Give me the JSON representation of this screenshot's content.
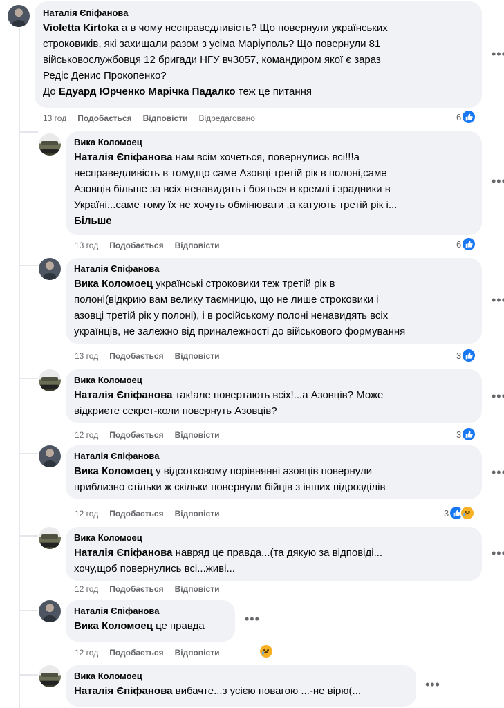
{
  "comments": [
    {
      "author": "Наталія Єпіфанова",
      "mentions": [
        "Violetta Kirtoka"
      ],
      "lines": [
        " а в чому несправедливість? Що повернули українських",
        "строковиків, які захищали разом з усіма Маріуполь? Що повернули 81",
        "військовослужбовця 12 бригади НГУ вч3057, командиром якої є зараз",
        "Редіс Денис Прокопенко?"
      ],
      "last_prefix": "До ",
      "last_mentions": "Едуард Юрченко Марічка Падалко",
      "last_suffix": " теж це питання",
      "time": "13 год",
      "like": "Подобається",
      "reply": "Відповісти",
      "edited": "Відредаговано",
      "reactions": "6"
    },
    {
      "author": "Вика Коломоец",
      "mention": "Наталія Єпіфанова",
      "lines": [
        " нам всім хочеться, повернулись всі!!!а",
        "несправедливість в тому,що саме Азовці третій рік в полоні,саме",
        "Азовців більше за всіх ненавидять і бояться в кремлі і зрадники в",
        "Україні...саме тому їх не хочуть обмінювати ,а катують третій рік і..."
      ],
      "more": "Більше",
      "time": "13 год",
      "like": "Подобається",
      "reply": "Відповісти",
      "reactions": "6"
    },
    {
      "author": "Наталія Єпіфанова",
      "mention": "Вика Коломоец",
      "lines": [
        " українські строковики теж третій рік в",
        "полоні(відкрию вам велику таємницю, що не лише строковики і",
        "азовці третій рік у полоні), і в російському полоні ненавидять всіх",
        "українців, не залежно від приналежності до військового формування"
      ],
      "time": "13 год",
      "like": "Подобається",
      "reply": "Відповісти",
      "reactions": "3"
    },
    {
      "author": "Вика Коломоец",
      "mention": "Наталія Єпіфанова",
      "lines": [
        " так!але повертають всіх!...а Азовців? Може",
        "відкриєте секрет-коли повернуть Азовців?"
      ],
      "time": "12 год",
      "like": "Подобається",
      "reply": "Відповісти",
      "reactions": "3"
    },
    {
      "author": "Наталія Єпіфанова",
      "mention": "Вика Коломоец",
      "lines": [
        " у відсотковому порівнянні азовців повернули",
        "приблизно стільки ж скільки повернули бійців з інших підрозділів"
      ],
      "time": "12 год",
      "like": "Подобається",
      "reply": "Відповісти",
      "reactions": "3"
    },
    {
      "author": "Вика Коломоец",
      "mention": "Наталія Єпіфанова",
      "lines": [
        " навряд це правда...(та дякую за відповіді...",
        "хочу,щоб повернулись всі...живі..."
      ],
      "time": "12 год",
      "like": "Подобається",
      "reply": "Відповісти"
    },
    {
      "author": "Наталія Єпіфанова",
      "mention": "Вика Коломоец",
      "lines": [
        " це правда"
      ],
      "time": "12 год",
      "like": "Подобається",
      "reply": "Відповісти"
    },
    {
      "author": "Вика Коломоец",
      "mention": "Наталія Єпіфанова",
      "lines": [
        " вибачте...з усією повагою ...-не вірю(..."
      ]
    }
  ],
  "more_icon": "more-options-icon",
  "like_icon": "like-reaction-icon",
  "sad_icon": "sad-reaction-icon",
  "colors": {
    "bubble": "#f0f2f5",
    "meta": "#65676b",
    "like": "#1877f2"
  }
}
